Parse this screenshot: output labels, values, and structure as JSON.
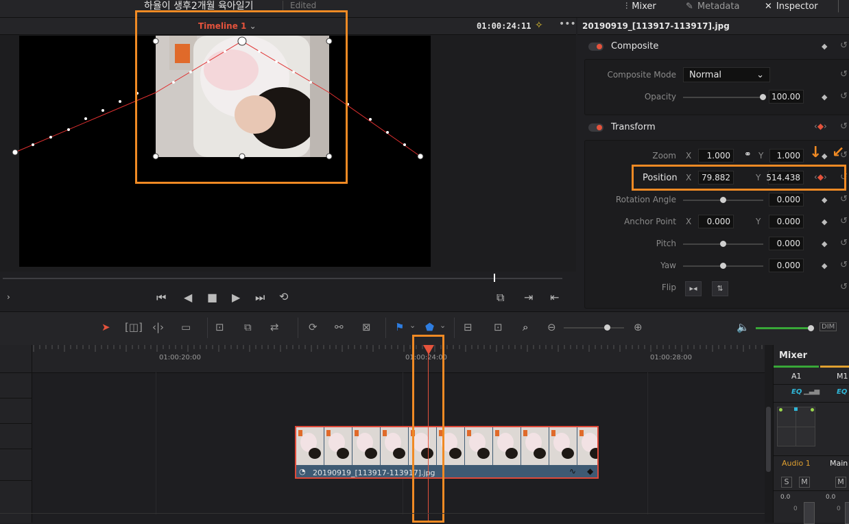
{
  "topbar": {
    "project_title": "하율이 생후2개월 육아일기",
    "edited": "Edited",
    "mixer": "Mixer",
    "metadata": "Metadata",
    "inspector": "Inspector"
  },
  "viewer": {
    "timeline_name": "Timeline 1",
    "timecode": "01:00:24:11"
  },
  "inspector": {
    "clip_title": "20190919_[113917-113917].jpg",
    "composite": {
      "header": "Composite",
      "mode_label": "Composite Mode",
      "mode_value": "Normal",
      "opacity_label": "Opacity",
      "opacity_value": "100.00",
      "opacity_level": 1.0
    },
    "transform": {
      "header": "Transform",
      "zoom_label": "Zoom",
      "zoom_x": "1.000",
      "zoom_y": "1.000",
      "position_label": "Position",
      "position_x": "79.882",
      "position_y": "514.438",
      "rotation_label": "Rotation Angle",
      "rotation_value": "0.000",
      "anchor_label": "Anchor Point",
      "anchor_x": "0.000",
      "anchor_y": "0.000",
      "pitch_label": "Pitch",
      "pitch_value": "0.000",
      "yaw_label": "Yaw",
      "yaw_value": "0.000",
      "flip_label": "Flip",
      "x": "X",
      "y": "Y"
    }
  },
  "timeline": {
    "ruler": [
      "01:00:20:00",
      "01:00:24:00",
      "01:00:28:00"
    ],
    "clip_name": "20190919_[113917-113917].jpg",
    "dim": "DIM"
  },
  "mixer": {
    "title": "Mixer",
    "ch1": "A1",
    "ch2": "M1",
    "eq": "EQ",
    "audio1": "Audio 1",
    "main": "Main",
    "s": "S",
    "m": "M",
    "db1": "0.0",
    "db2": "0.0",
    "zero": "0"
  },
  "colors": {
    "accent": "#e5533c",
    "highlight": "#f08a24",
    "clip": "#3e5a73"
  }
}
